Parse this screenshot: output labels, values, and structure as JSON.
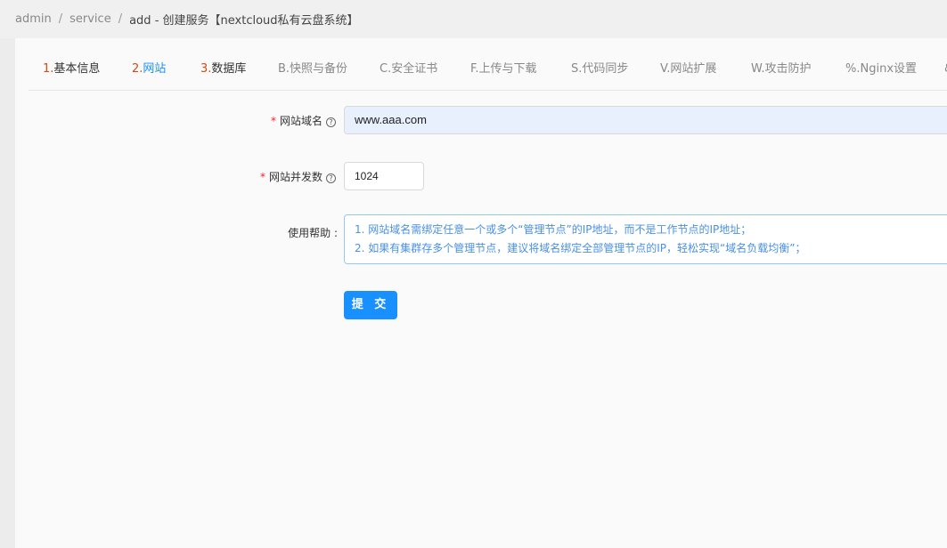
{
  "breadcrumb": {
    "items": [
      "admin",
      "service"
    ],
    "separator": "/",
    "current": "add - 创建服务【nextcloud私有云盘系统】"
  },
  "tabs": [
    {
      "num": "1.",
      "label": "基本信息",
      "state": "done"
    },
    {
      "num": "2.",
      "label": "网站",
      "state": "active"
    },
    {
      "num": "3.",
      "label": "数据库",
      "state": "done"
    },
    {
      "num": "",
      "label": "B.快照与备份",
      "state": "pending"
    },
    {
      "num": "",
      "label": "C.安全证书",
      "state": "pending"
    },
    {
      "num": "",
      "label": "F.上传与下载",
      "state": "pending"
    },
    {
      "num": "",
      "label": "S.代码同步",
      "state": "pending"
    },
    {
      "num": "",
      "label": "V.网站扩展",
      "state": "pending"
    },
    {
      "num": "",
      "label": "W.攻击防护",
      "state": "pending"
    },
    {
      "num": "",
      "label": "%.Nginx设置",
      "state": "pending"
    },
    {
      "num": "",
      "label": "&",
      "state": "pending"
    }
  ],
  "form": {
    "domain": {
      "required_mark": "*",
      "label": "网站域名",
      "value": "www.aaa.com"
    },
    "concurrency": {
      "required_mark": "*",
      "label": "网站并发数",
      "value": "1024"
    },
    "help": {
      "label": "使用帮助 :",
      "lines": [
        "1. 网站域名需绑定任意一个或多个“管理节点”的IP地址，而不是工作节点的IP地址；",
        "2. 如果有集群存多个管理节点，建议将域名绑定全部管理节点的IP，轻松实现“域名负载均衡”；"
      ]
    },
    "submit_label": "提 交"
  },
  "colors": {
    "accent": "#1890ff",
    "step_number": "#d9480f",
    "required": "#f5222d",
    "help_text": "#4a90e2"
  },
  "icons": {
    "help": "question-circle-icon"
  }
}
